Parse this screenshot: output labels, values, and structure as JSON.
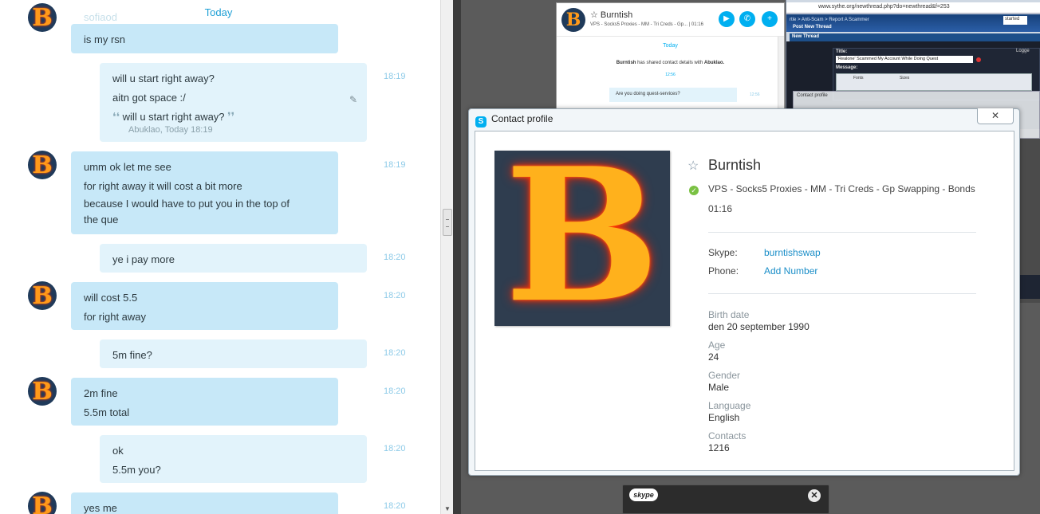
{
  "chat": {
    "today": "Today",
    "faded_name": "sofiaod",
    "messages": [
      {
        "lines": [
          "is my rsn"
        ]
      },
      {
        "lines": [
          "will u  start right away?",
          "aitn got space :/"
        ],
        "quote": "will u  start right away?",
        "quote_meta": "Abuklao, Today 18:19",
        "time": "18:19"
      },
      {
        "lines": [
          "umm ok let me see",
          "for right away it will cost a bit more",
          "because I would have to put you in the top of",
          "the que"
        ],
        "time": "18:19"
      },
      {
        "lines": [
          "ye i pay more"
        ],
        "time": "18:20"
      },
      {
        "lines": [
          "will cost 5.5",
          "for right away"
        ],
        "time": "18:20"
      },
      {
        "lines": [
          "5m fine?"
        ],
        "time": "18:20"
      },
      {
        "lines": [
          "2m fine",
          "5.5m total"
        ],
        "time": "18:20"
      },
      {
        "lines": [
          "ok",
          "5.5m you?"
        ],
        "time": "18:20"
      },
      {
        "lines": [
          "yes me"
        ],
        "time": "18:20"
      }
    ],
    "avatar_letter": "B"
  },
  "bg_skype": {
    "name": "Burntish",
    "mood": "VPS - Socks5 Proxies - MM - Tri Creds - Gp...  |  01:16",
    "today": "Today",
    "shared_name": "Burntish",
    "shared_rest": " has shared contact details with ",
    "shared_with": "Abuklao.",
    "shared_time": "12:56",
    "bubble": "Are you doing quest-services?",
    "bubble_time": "12:56"
  },
  "browser": {
    "url": "www.sythe.org/newthread.php?do=newthread&f=253",
    "crumb": "rtle > Anti-Scam > Report A Scammer",
    "crumb2": "Post New Thread",
    "search": "started",
    "section": "New Thread",
    "title_label": "Title:",
    "title_value": "'Realone' Scammed My Account While Doing Quest",
    "message_label": "Message:",
    "fonts": "Fonts",
    "sizes": "Sizes",
    "logged": "Logge",
    "ghost_title": "Contact profile"
  },
  "toast": {
    "logo": "skype"
  },
  "profile": {
    "dialog_title": "Contact profile",
    "close_glyph": "✕",
    "name": "Burntish",
    "mood": "VPS - Socks5 Proxies - MM - Tri Creds - Gp Swapping - Bonds",
    "local_time": "01:16",
    "skype_label": "Skype:",
    "skype_value": "burntishswap",
    "phone_label": "Phone:",
    "phone_value": "Add Number",
    "fields": [
      {
        "label": "Birth date",
        "value": "den 20 september 1990"
      },
      {
        "label": "Age",
        "value": "24"
      },
      {
        "label": "Gender",
        "value": "Male"
      },
      {
        "label": "Language",
        "value": "English"
      },
      {
        "label": "Contacts",
        "value": "1216"
      }
    ],
    "avatar_letter": "B"
  },
  "colors": {
    "accent": "#1fa0d6",
    "incoming_bubble": "#c7e8f8",
    "outgoing_bubble": "#e2f3fb",
    "online": "#7ac143",
    "link": "#1a8ec8"
  }
}
